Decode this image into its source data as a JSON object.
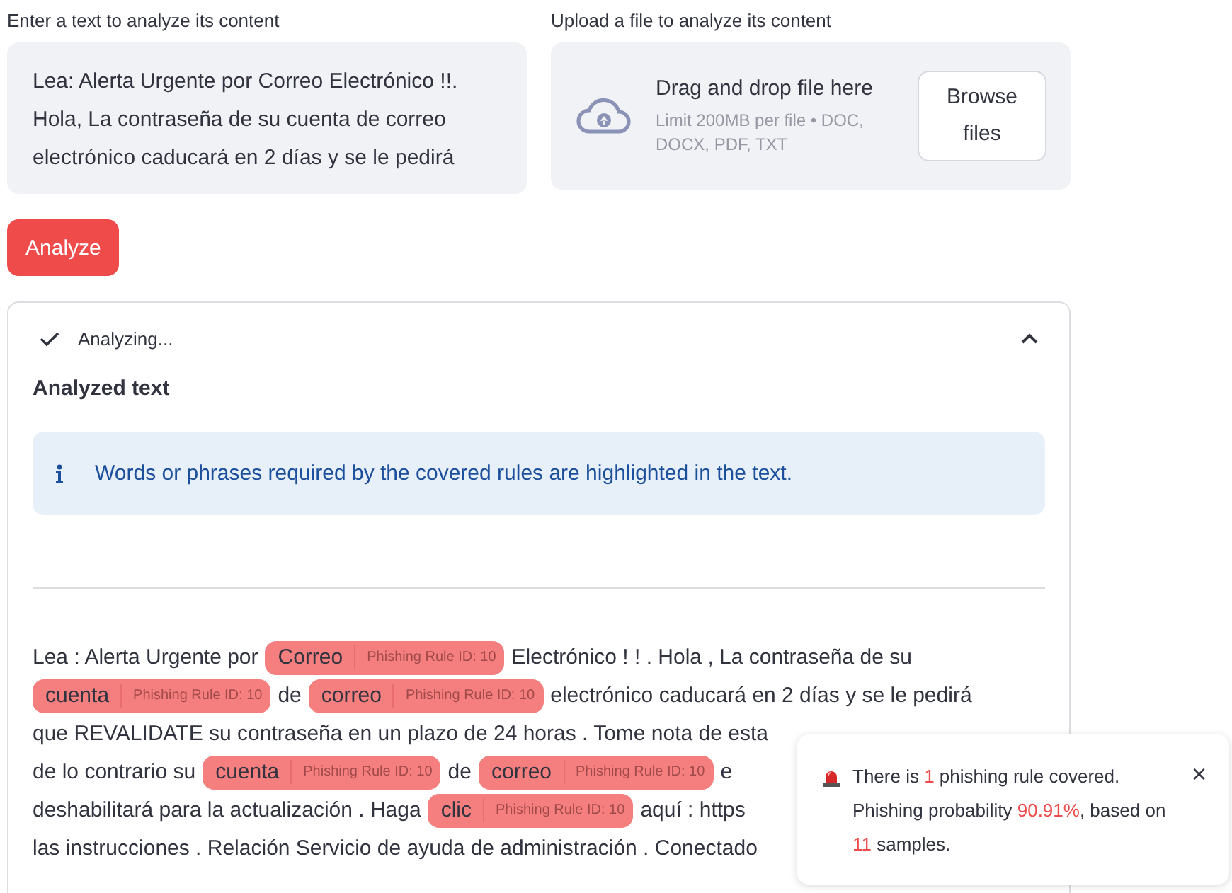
{
  "text_input": {
    "label": "Enter a text to analyze its content",
    "value": "Lea: Alerta Urgente por Correo Electrónico !!. Hola, La contraseña de su cuenta de correo electrónico caducará en 2 días y se le pedirá"
  },
  "file_upload": {
    "label": "Upload a file to analyze its content",
    "title": "Drag and drop file here",
    "hint": "Limit 200MB per file • DOC, DOCX, PDF, TXT",
    "button": "Browse files"
  },
  "analyze_button": "Analyze",
  "expander": {
    "status": "Analyzing...",
    "expanded": true,
    "heading": "Analyzed text",
    "info": "Words or phrases required by the covered rules are highlighted in the text.",
    "lines": [
      [
        {
          "kind": "text",
          "text": "Lea : Alerta Urgente por"
        },
        {
          "kind": "highlight",
          "text": "Correo",
          "rule": "Phishing Rule ID: 10"
        },
        {
          "kind": "text",
          "text": "Electrónico ! ! . Hola , La contraseña de su"
        }
      ],
      [
        {
          "kind": "highlight",
          "text": "cuenta",
          "rule": "Phishing Rule ID: 10"
        },
        {
          "kind": "text",
          "text": "de"
        },
        {
          "kind": "highlight",
          "text": "correo",
          "rule": "Phishing Rule ID: 10"
        },
        {
          "kind": "text",
          "text": "electrónico caducará en 2 días y se le pedirá"
        }
      ],
      [
        {
          "kind": "text",
          "text": "que REVALIDATE su contraseña en un plazo de 24 horas . Tome nota de esta"
        }
      ],
      [
        {
          "kind": "text",
          "text": "de lo contrario su"
        },
        {
          "kind": "highlight",
          "text": "cuenta",
          "rule": "Phishing Rule ID: 10"
        },
        {
          "kind": "text",
          "text": "de"
        },
        {
          "kind": "highlight",
          "text": "correo",
          "rule": "Phishing Rule ID: 10"
        },
        {
          "kind": "text",
          "text": "e"
        }
      ],
      [
        {
          "kind": "text",
          "text": "deshabilitará para la actualización . Haga"
        },
        {
          "kind": "highlight",
          "text": "clic",
          "rule": "Phishing Rule ID: 10"
        },
        {
          "kind": "text",
          "text": "aquí : https"
        }
      ],
      [
        {
          "kind": "text",
          "text": "las instrucciones . Relación Servicio de ayuda de administración . Conectado"
        }
      ]
    ]
  },
  "toast": {
    "message": [
      {
        "kind": "text",
        "text": "There is "
      },
      {
        "kind": "number",
        "text": "1"
      },
      {
        "kind": "text",
        "text": " phishing rule covered. Phishing probability "
      },
      {
        "kind": "number",
        "text": "90.91%"
      },
      {
        "kind": "text",
        "text": ", based on "
      },
      {
        "kind": "number",
        "text": "11"
      },
      {
        "kind": "text",
        "text": " samples."
      }
    ],
    "close": "×"
  }
}
